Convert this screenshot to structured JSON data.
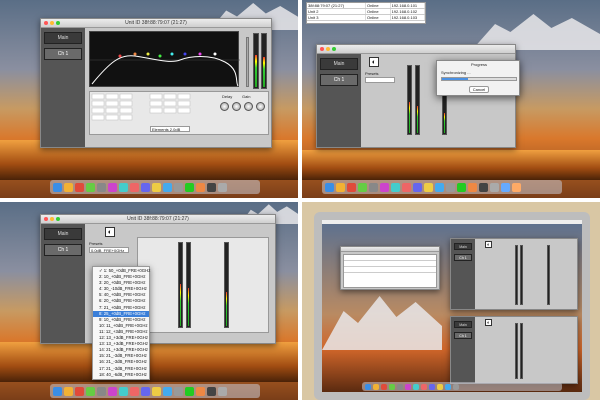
{
  "quad1": {
    "window_title": "Unit ID 38f:88:79:07 (21:27)",
    "sidebar": [
      "Main",
      "Ch 1"
    ],
    "side_labels": [
      "Delay",
      "Gain",
      "Phase"
    ],
    "preset_value": "Elements 2.0dB"
  },
  "quad2": {
    "list_rows": [
      {
        "name": "38f:88:79:07 (21:27)",
        "status": "Online",
        "id": "192.168.0.101"
      },
      {
        "name": "Unit 2",
        "status": "Online",
        "id": "192.168.0.102"
      },
      {
        "name": "Unit 3",
        "status": "Online",
        "id": "192.168.0.103"
      }
    ],
    "sidebar": [
      "Main",
      "Ch 1"
    ],
    "dialog_title": "Progress",
    "dialog_message": "Synchronizing ...",
    "dialog_button": "Cancel",
    "progress": 0.35,
    "preset_label": "Presets"
  },
  "quad3": {
    "window_title": "Unit ID 38f:88:79:07 (21:27)",
    "sidebar": [
      "Main",
      "Ch 1"
    ],
    "preset_label": "Presets",
    "preset_value": "0.0dB_FRE+0GHz",
    "options": [
      "✓ 1: 50_+0dB_FRE+0GHz",
      "2: 10_+0dB_FRE+0GHz",
      "3: 20_+0dB_FRE+0GHz",
      "4: 30_-10dB_FRE+0GHz",
      "5: 40_+0dB_FRE+0GHz",
      "6: 20_+0dB_FRE+0GHz",
      "7: 21_+0dB_FRE+0GHz",
      "8: 25_+0dB_FRE+0GHz",
      "9: 10_+0dB_FRE+0GHz",
      "10: 11_+0dB_FRE+0GHz",
      "11: 12_+3dB_FRE+0GHz",
      "12: 13_+3dB_FRE+0GHz",
      "13: 13_+3dB_FRE+0GHz",
      "14: 21_+3dB_FRE+0GHz",
      "15: 21_-3dB_FRE+0GHz",
      "16: 21_-3dB_FRE+0GHz",
      "17: 21_-3dB_FRE+0GHz",
      "18: 40_-6dB_FRE+0GHz"
    ],
    "selected_index": 7
  },
  "quad4": {
    "sidebar_top": [
      "Main",
      "Ch 1"
    ],
    "sidebar_bottom": [
      "Main",
      "Ch 1"
    ]
  },
  "colors": {
    "accent": "#3b7fd9",
    "meter_green": "#2a2",
    "sidebar_dark": "#555555"
  }
}
